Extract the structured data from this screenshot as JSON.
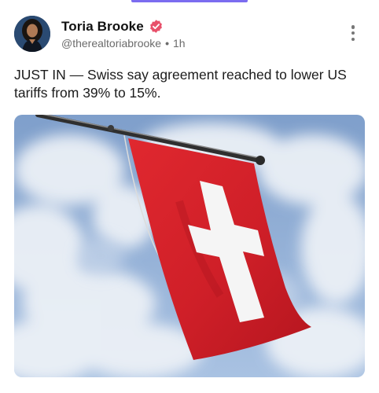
{
  "post": {
    "author_name": "Toria Brooke",
    "handle": "@therealtoriabrooke",
    "time": "1h",
    "separator": "•",
    "text": "JUST IN — Swiss say agreement reached to lower US tariffs from 39% to 15%.",
    "verified": true
  },
  "icons": {
    "verified": "verified-badge-icon",
    "more": "more-vertical-icon"
  },
  "colors": {
    "accent": "#7b6cf0",
    "verified_badge": "#e8506a",
    "flag_red": "#d4202a",
    "sky": "#8fb0d8"
  }
}
